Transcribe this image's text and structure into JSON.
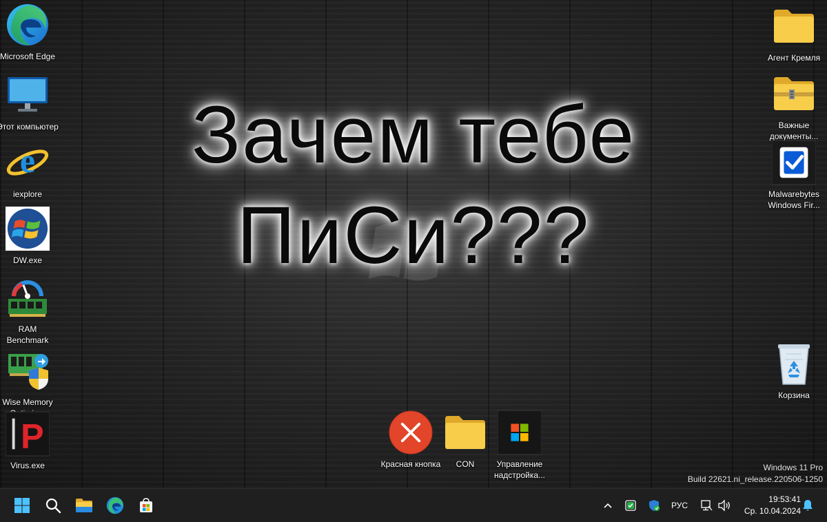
{
  "headline": {
    "line1": "Зачем тебе",
    "line2": "ПиСи???"
  },
  "desktop_icons_left": [
    {
      "label": "Microsoft Edge",
      "icon": "edge-icon"
    },
    {
      "label": "Этот компьютер",
      "icon": "monitor-icon"
    },
    {
      "label": "iexplore",
      "icon": "internet-explorer-icon"
    },
    {
      "label": "DW.exe",
      "icon": "windows-logo-icon"
    },
    {
      "label": "RAM Benchmark",
      "icon": "ram-gauge-icon"
    },
    {
      "label": "Wise Memory Optimizer",
      "icon": "memory-shield-icon"
    },
    {
      "label": "Virus.exe",
      "icon": "red-p-icon"
    }
  ],
  "desktop_icons_right": [
    {
      "label": "Агент Кремля",
      "icon": "folder-icon"
    },
    {
      "label": "Важные документы...",
      "icon": "zip-folder-icon"
    },
    {
      "label": "Malwarebytes Windows Fir...",
      "icon": "checkbox-icon"
    },
    {
      "label": "Корзина",
      "icon": "recycle-bin-icon"
    }
  ],
  "desktop_icons_bottom": [
    {
      "label": "Красная кнопка",
      "icon": "red-x-button-icon"
    },
    {
      "label": "CON",
      "icon": "folder-icon"
    },
    {
      "label": "Управление надстройка...",
      "icon": "microsoft-logo-icon"
    }
  ],
  "watermark": {
    "edition": "Windows 11 Pro",
    "build": "Build 22621.ni_release.220506-1250"
  },
  "taskbar": {
    "apps": [
      "start-icon",
      "search-icon",
      "file-explorer-icon",
      "edge-icon",
      "store-icon"
    ],
    "tray": {
      "language": "РУС",
      "time": "19:53:41",
      "date": "Ср. 10.04.2024"
    }
  },
  "colors": {
    "taskbar_bg": "#1f1f1f",
    "red_button": "#e2452a",
    "folder_yellow": "#f4c542",
    "accent_blue": "#0a5bd6"
  }
}
